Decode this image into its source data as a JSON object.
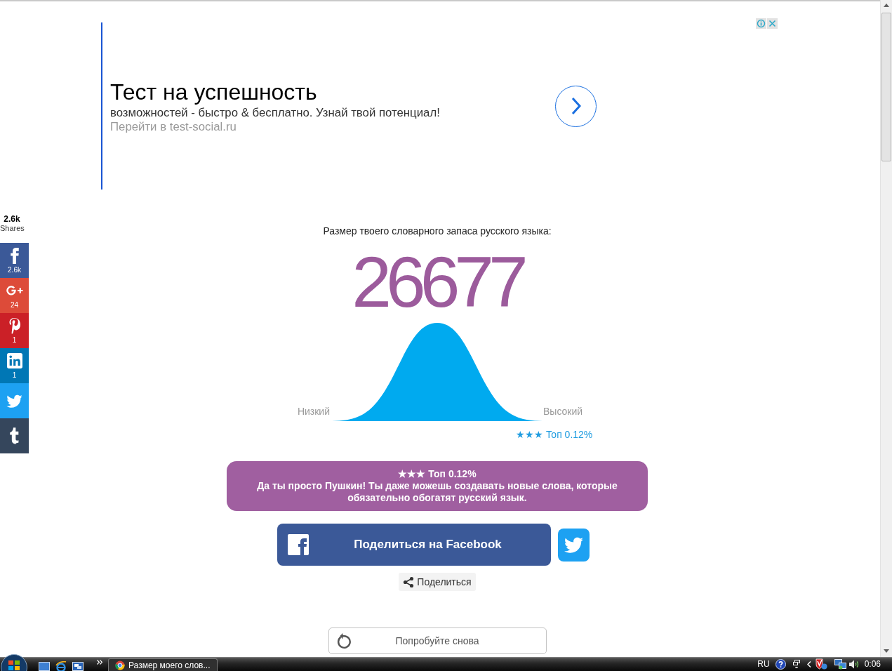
{
  "ad": {
    "title": "Тест на успешность",
    "description": "возможностей - быстро & бесплатно. Узнай твой потенциал!",
    "display_url": "Перейти в test-social.ru"
  },
  "share_sidebar": {
    "total": "2.6k",
    "total_label": "Shares",
    "buttons": [
      {
        "kind": "facebook",
        "color": "#3b5998",
        "count": "2.6k"
      },
      {
        "kind": "google-plus",
        "color": "#dd4b39",
        "count": "24"
      },
      {
        "kind": "pinterest",
        "color": "#cb2027",
        "count": "1"
      },
      {
        "kind": "linkedin",
        "color": "#0077b5",
        "count": "1"
      },
      {
        "kind": "twitter",
        "color": "#1da1f2"
      },
      {
        "kind": "tumblr",
        "color": "#35465c"
      }
    ]
  },
  "result": {
    "heading": "Размер твоего словарного запаса русского языка:",
    "score": "26677",
    "low_label": "Низкий",
    "high_label": "Высокий",
    "rank": "★★★ Топ 0.12%"
  },
  "verdict": {
    "rank": "★★★ Топ 0.12%",
    "message": "Да ты просто Пушкин! Ты даже можешь создавать новые слова, которые обязательно обогатят русский язык."
  },
  "share_buttons": {
    "facebook": "Поделиться на Facebook",
    "share": "Поделиться"
  },
  "retry_button": "Попробуйте снова",
  "taskbar": {
    "task": "Размер моего слов...",
    "language": "RU",
    "clock": "0:06"
  }
}
